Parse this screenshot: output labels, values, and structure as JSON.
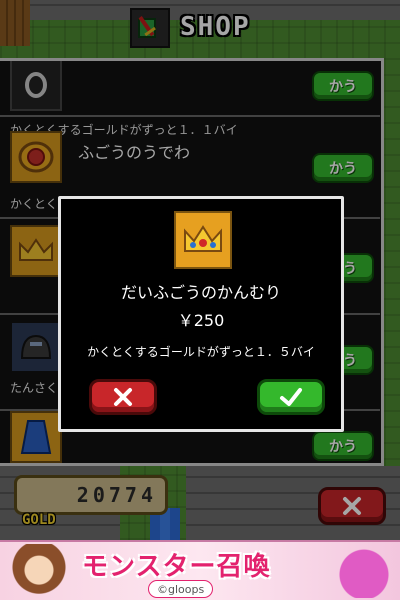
{
  "header": {
    "title": "SHOP",
    "icon": "sword-shield-icon"
  },
  "items": [
    {
      "name": "",
      "desc": "かくとくするゴールドがずっと１．１バイ",
      "buy_label": "かう",
      "icon": "ring-icon"
    },
    {
      "name": "ふごうのうでわ",
      "desc": "かくとくするゴールドがずっと１．３バイ",
      "buy_label": "かう",
      "icon": "bracelet-icon"
    },
    {
      "name": "",
      "desc": "",
      "buy_label": "かう",
      "icon": "crown-icon"
    },
    {
      "name": "",
      "desc": "たんさく",
      "buy_label": "かう",
      "icon": "helmet-icon"
    },
    {
      "name": "",
      "desc": "",
      "buy_label": "かう",
      "icon": "cape-icon"
    }
  ],
  "gold": {
    "amount": "20774",
    "label": "GOLD"
  },
  "modal": {
    "item_name": "だいふごうのかんむり",
    "price": "￥250",
    "desc": "かくとくするゴールドがずっと１．５バイ",
    "icon": "crown-icon"
  },
  "ad": {
    "title": "モンスター召喚",
    "brand": "©gloops",
    "colors": {
      "accent": "#e3226e"
    }
  }
}
